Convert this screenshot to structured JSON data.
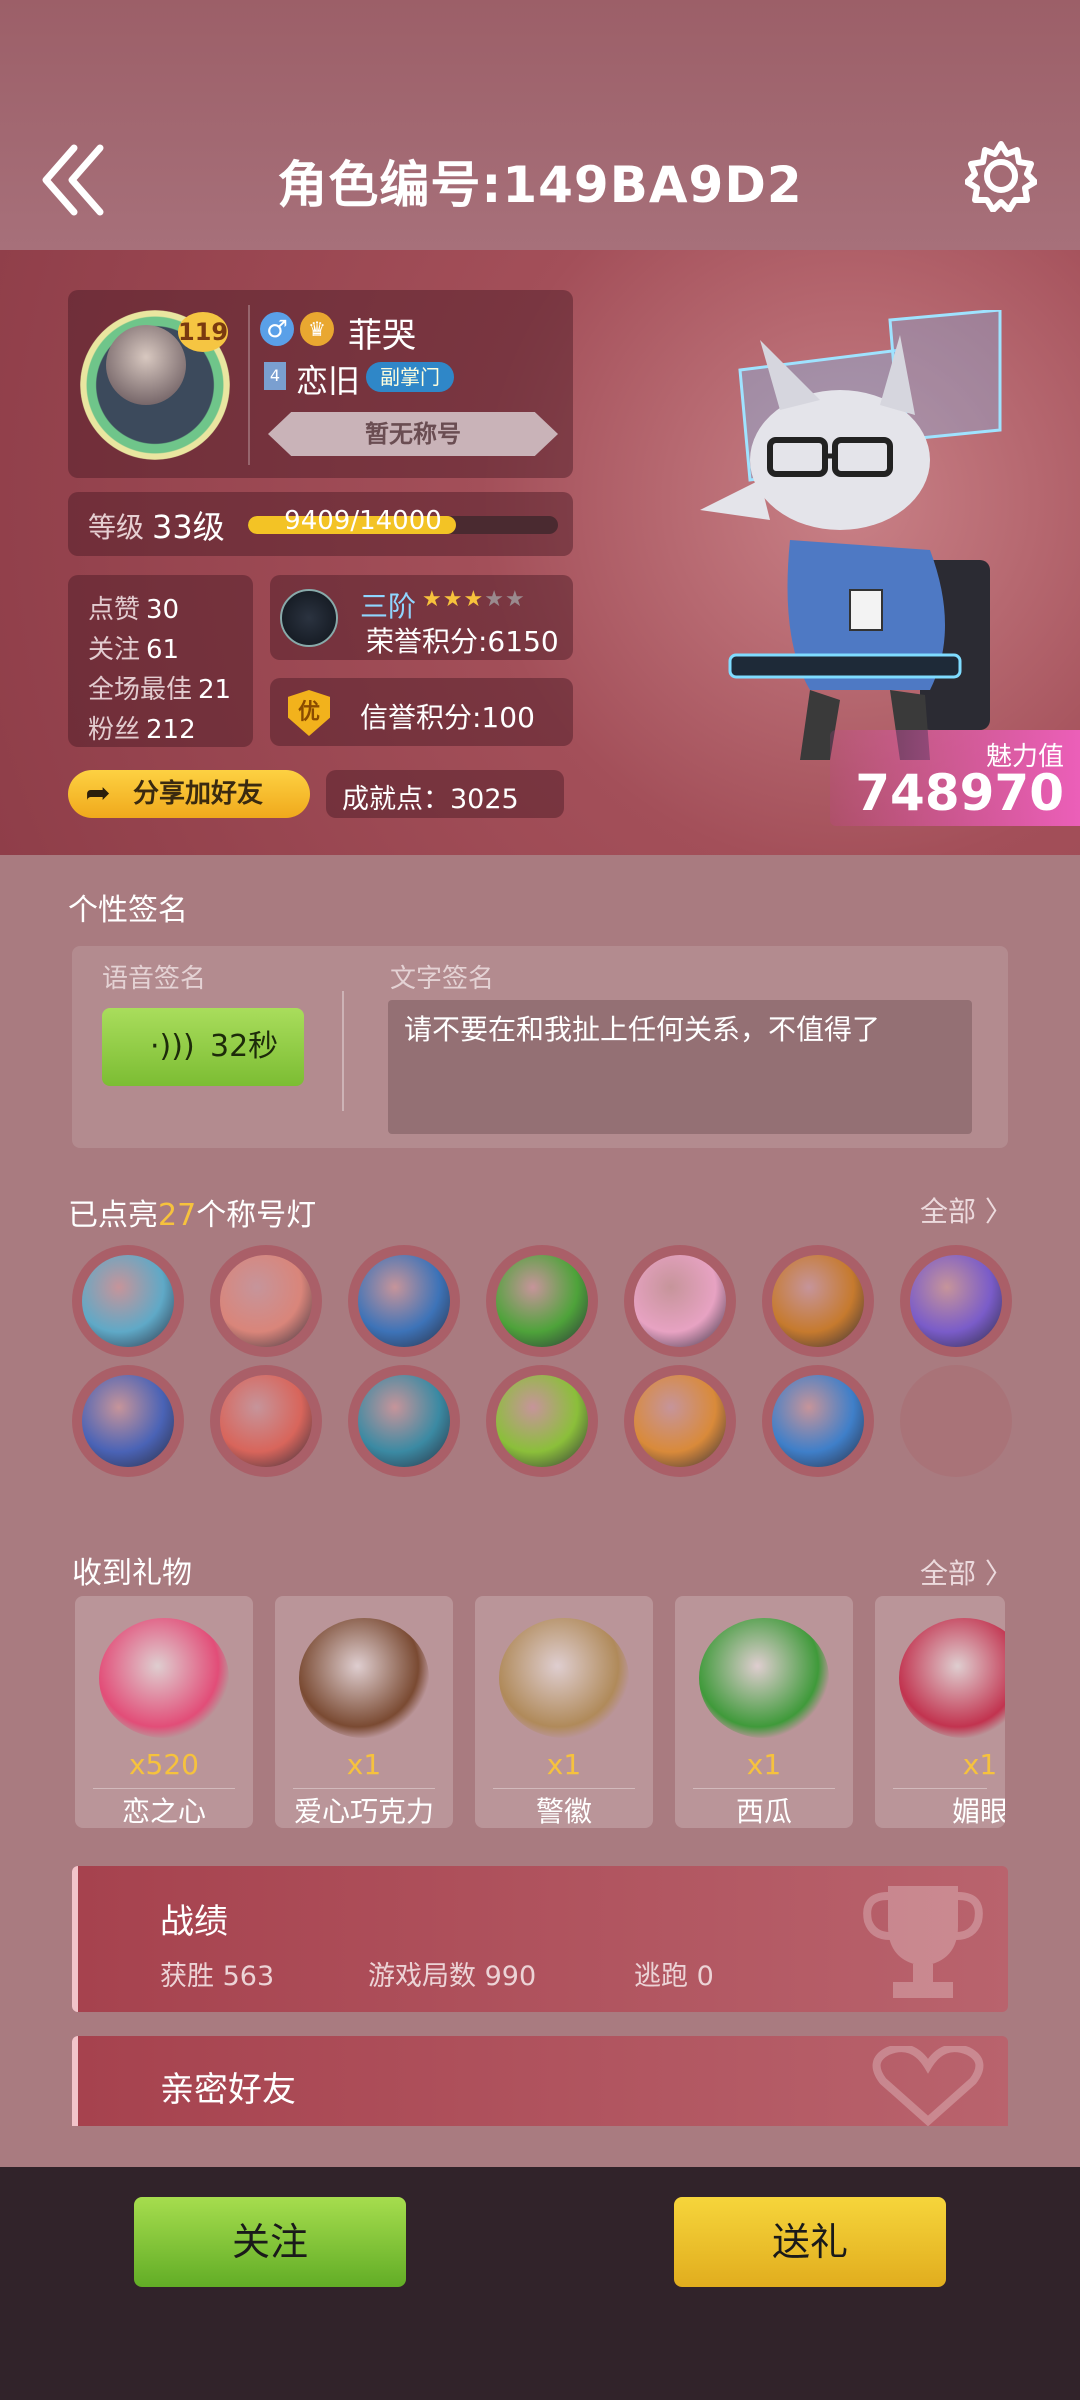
{
  "header": {
    "title": "角色编号:149BA9D2"
  },
  "profile": {
    "level_badge": "119",
    "gender_symbol": "♂",
    "crown_symbol": "♛",
    "name": "菲哭",
    "guild_icon_text": "4",
    "guild_name": "恋旧",
    "guild_role": "副掌门",
    "title_badge": "暂无称号",
    "level_label": "等级",
    "level_value": "33级",
    "xp_text": "9409/14000",
    "xp_fraction": 0.672,
    "stats": [
      {
        "label": "点赞",
        "value": "30"
      },
      {
        "label": "关注",
        "value": "61"
      },
      {
        "label": "全场最佳",
        "value": "21"
      },
      {
        "label": "粉丝",
        "value": "212"
      }
    ],
    "rank_tier": "三阶",
    "rank_stars_on": 3,
    "rank_stars_total": 5,
    "rank_points": "荣誉积分:6150",
    "credit_icon": "优",
    "credit_points": "信誉积分:100",
    "share_label": "分享加好友",
    "achievement": "成就点：3025",
    "charm_label": "魅力值",
    "charm_value": "748970"
  },
  "signature": {
    "title": "个性签名",
    "voice_label": "语音签名",
    "voice_duration": "32秒",
    "text_label": "文字签名",
    "text": "请不要在和我扯上任何关系，不值得了"
  },
  "lamps": {
    "title_prefix": "已点亮",
    "count": "27",
    "title_suffix": "个称号灯",
    "all_link": "全部 〉",
    "items": [
      {
        "icon": "bow-icon",
        "color": "#5fa9c7"
      },
      {
        "icon": "love-letter-icon",
        "color": "#d9857a"
      },
      {
        "icon": "wolf-icon",
        "color": "#3d73b8"
      },
      {
        "icon": "watermelon-icon",
        "color": "#4ea33a"
      },
      {
        "icon": "pink-doll-icon",
        "color": "#e7a2c2"
      },
      {
        "icon": "gingerbread-icon",
        "color": "#c67a2e"
      },
      {
        "icon": "purple-cards-icon",
        "color": "#7a5cc9"
      },
      {
        "icon": "crossbow-icon",
        "color": "#4a63b6"
      },
      {
        "icon": "potion-bottles-icon",
        "color": "#d8655b"
      },
      {
        "icon": "werewolf-icon",
        "color": "#3b8aa3"
      },
      {
        "icon": "bamboo-icon",
        "color": "#8bbf3a"
      },
      {
        "icon": "broken-hand-icon",
        "color": "#d98a3a"
      },
      {
        "icon": "lightning-wolf-icon",
        "color": "#3f7fc9"
      }
    ]
  },
  "gifts": {
    "title": "收到礼物",
    "all_link": "全部 〉",
    "items": [
      {
        "icon": "crystal-heart-icon",
        "count": "x520",
        "name": "恋之心",
        "color": "#e24d78"
      },
      {
        "icon": "chocolate-heart-icon",
        "count": "x1",
        "name": "爱心巧克力",
        "color": "#7a4a32"
      },
      {
        "icon": "police-badge-icon",
        "count": "x1",
        "name": "警徽",
        "color": "#b08a5a"
      },
      {
        "icon": "watermelon-icon",
        "count": "x1",
        "name": "西瓜",
        "color": "#3f9a3a"
      },
      {
        "icon": "charming-eye-icon",
        "count": "x1",
        "name": "媚眼",
        "color": "#c2334f"
      }
    ]
  },
  "record": {
    "title": "战绩",
    "wins": "获胜 563",
    "games": "游戏局数 990",
    "escapes": "逃跑 0"
  },
  "friends": {
    "title": "亲密好友"
  },
  "bottom": {
    "follow": "关注",
    "gift": "送礼"
  }
}
